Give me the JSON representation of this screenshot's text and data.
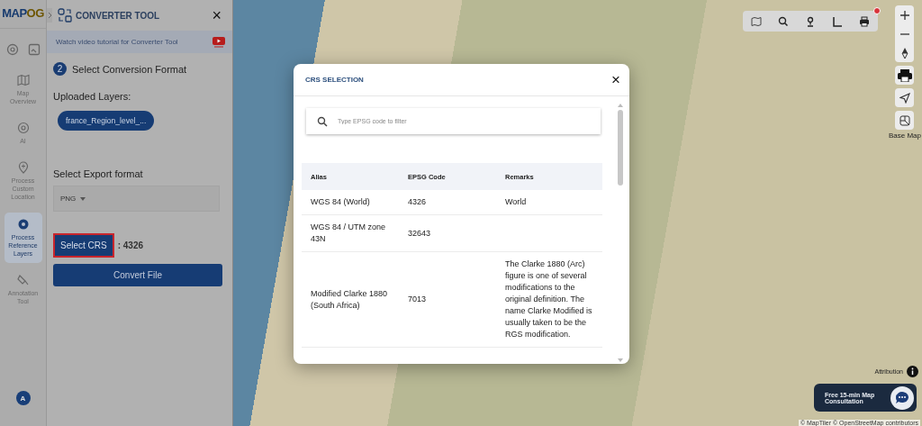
{
  "rail": {
    "logo": {
      "main": "MAP",
      "accent": "OG"
    },
    "items": [
      {
        "label": "Map Overview",
        "selected": false
      },
      {
        "label": "AI",
        "selected": false
      },
      {
        "label": "Process Custom Location",
        "selected": false
      },
      {
        "label": "Process Reference Layers",
        "selected": true
      },
      {
        "label": "Annotation Tool",
        "selected": false
      }
    ],
    "avatar": "A"
  },
  "panel": {
    "title": "CONVERTER TOOL",
    "close": "×",
    "tutorial": "Watch video tutorial for Converter Tool",
    "step": {
      "number": "2",
      "title": "Select Conversion Format"
    },
    "uploaded_label": "Uploaded Layers:",
    "layers": [
      "france_Region_level_..."
    ],
    "export_label": "Select Export format",
    "export_value": "PNG",
    "crs_button": "Select CRS",
    "crs_highlighted": true,
    "crs_value": ": 4326",
    "convert_button": "Convert File"
  },
  "modal": {
    "title": "CRS SELECTION",
    "close": "×",
    "search": {
      "placeholder": "Type EPSG code to filter"
    },
    "columns": [
      "Alias",
      "EPSG Code",
      "Remarks"
    ],
    "rows": [
      [
        "WGS 84 (World)",
        "4326",
        "World"
      ],
      [
        "WGS 84 / UTM zone 43N",
        "32643",
        ""
      ],
      [
        "Modified Clarke 1880 (South Africa)",
        "7013",
        "The Clarke 1880 (Arc) figure is one of several modifications to the original definition. The name Clarke Modified is usually taken to be the RGS modification."
      ]
    ]
  },
  "map": {
    "toolbar_notification": true,
    "base_map_label": "Base Map",
    "attribution": "Attribution",
    "consult_button": "Free 15-min Map Consultation",
    "copyright": "© MapTiler © OpenStreetMap contributors"
  }
}
